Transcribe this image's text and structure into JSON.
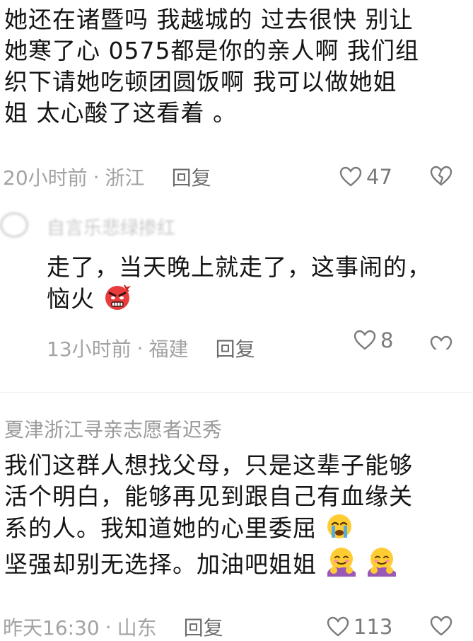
{
  "comment1": {
    "lines": [
      "她还在诸暨吗 我越城的 过去很快 别让",
      "她寒了心 0575都是你的亲人啊 我们组",
      "织下请她吃顿团圆饭啊 我可以做她姐",
      "姐 太心酸了这看着 。"
    ],
    "time": "20小时前",
    "sep": "·",
    "location": "浙江",
    "reply_label": "回复",
    "likes": "47"
  },
  "reply1": {
    "author": "自言乐悲绿掺红",
    "lines": [
      "走了，当天晚上就走了，这事闹的，",
      "恼火"
    ],
    "emoji": "angry-face-emoji",
    "time": "13小时前",
    "sep": "·",
    "location": "福建",
    "reply_label": "回复",
    "likes": "8"
  },
  "comment2": {
    "author": "夏津浙江寻亲志愿者迟秀",
    "lines": [
      "我们这群人想找父母，只是这辈子能够",
      "活个明白，能够再见到跟自己有血缘关",
      "系的人。我知道她的心里委屈",
      "坚强却别无选择。加油吧姐姐"
    ],
    "emojis": [
      "crying-face-emoji",
      "hugging-face-emoji",
      "hugging-face-emoji"
    ],
    "time": "昨天16:30",
    "sep": "·",
    "location": "山东",
    "reply_label": "回复",
    "likes": "113"
  },
  "colors": {
    "text": "#141414",
    "meta": "#a3a3a3",
    "icon": "#7a7a7a"
  }
}
